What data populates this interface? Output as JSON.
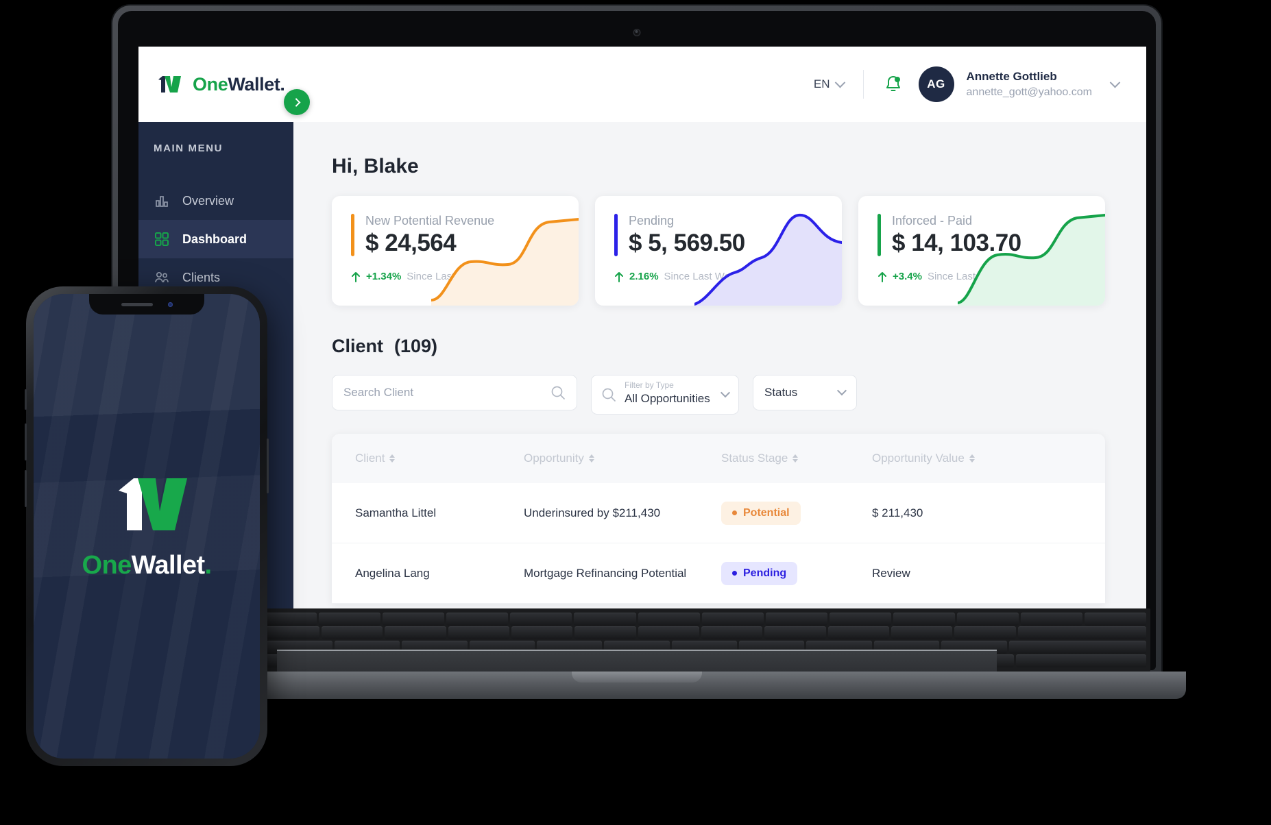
{
  "brand": {
    "logo_one": "One",
    "logo_wallet": "Wallet.",
    "mark_icon": "onewallet-1w-logo-mark"
  },
  "topbar": {
    "language": "EN",
    "language_chevron_icon": "chevron-down-icon",
    "bell_icon": "notification-bell-icon",
    "avatar_initials": "AG",
    "user_name": "Annette Gottlieb",
    "user_email": "annette_gott@yahoo.com",
    "user_chevron_icon": "chevron-down-icon"
  },
  "sidebar": {
    "menu_title": "MAIN MENU",
    "toggle_icon": "chevron-right-icon",
    "items": [
      {
        "label": "Overview",
        "icon": "bar-chart-icon",
        "active": false
      },
      {
        "label": "Dashboard",
        "icon": "grid-squares-icon",
        "active": true
      },
      {
        "label": "Clients",
        "icon": "people-icon",
        "active": false
      }
    ]
  },
  "main": {
    "greeting": "Hi, Blake",
    "stats": [
      {
        "label": "New Potential Revenue",
        "value": "$ 24,564",
        "delta": "+1.34%",
        "delta_caption": "Since Last Week",
        "accent": "#F2911B",
        "fill": "#FDF1E3",
        "trend_icon": "arrow-up-icon"
      },
      {
        "label": "Pending",
        "value": "$ 5, 569.50",
        "delta": "2.16%",
        "delta_caption": "Since Last Week",
        "accent": "#2B21E8",
        "fill": "#E3E1FB",
        "trend_icon": "arrow-up-icon"
      },
      {
        "label": "Inforced - Paid",
        "value": "$ 14, 103.70",
        "delta": "+3.4%",
        "delta_caption": "Since Last Week",
        "accent": "#16A34A",
        "fill": "#E2F6E9",
        "trend_icon": "arrow-up-icon"
      }
    ],
    "client_section": {
      "title": "Client",
      "count": "(109)"
    },
    "filters": {
      "search_placeholder": "Search Client",
      "search_value": "",
      "search_icon": "search-icon",
      "type_label": "Filter by Type",
      "type_value": "All Opportunities",
      "type_icon": "search-icon",
      "type_chevron_icon": "chevron-down-icon",
      "status_value": "Status",
      "status_chevron_icon": "chevron-down-icon"
    },
    "table": {
      "columns": [
        {
          "label": "Client",
          "sort_icon": "sort-arrows-icon"
        },
        {
          "label": "Opportunity",
          "sort_icon": "sort-arrows-icon"
        },
        {
          "label": "Status Stage",
          "sort_icon": "sort-arrows-icon"
        },
        {
          "label": "Opportunity Value",
          "sort_icon": "sort-arrows-icon"
        }
      ],
      "rows": [
        {
          "client": "Samantha Littel",
          "opportunity": "Underinsured by $211,430",
          "status": "Potential",
          "status_kind": "potential",
          "value": "$ 211,430"
        },
        {
          "client": "Angelina Lang",
          "opportunity": "Mortgage Refinancing Potential",
          "status": "Pending",
          "status_kind": "pending",
          "value": "Review"
        }
      ]
    }
  },
  "phone": {
    "splash_one": "One",
    "splash_wallet": "Wallet",
    "splash_dot": ".",
    "mark_icon": "onewallet-1w-logo-mark"
  },
  "chart_data": [
    {
      "type": "area",
      "title": "New Potential Revenue",
      "x": [
        0,
        1,
        2,
        3,
        4,
        5,
        6
      ],
      "values": [
        12,
        30,
        44,
        42,
        40,
        66,
        96
      ],
      "color": "#F2911B",
      "fill": "#FDF1E3",
      "grid": false,
      "legend": "none"
    },
    {
      "type": "area",
      "title": "Pending",
      "x": [
        0,
        1,
        2,
        3,
        4,
        5,
        6
      ],
      "values": [
        6,
        28,
        46,
        50,
        92,
        72,
        70
      ],
      "color": "#2B21E8",
      "fill": "#E3E1FB",
      "grid": false,
      "legend": "none"
    },
    {
      "type": "area",
      "title": "Inforced - Paid",
      "x": [
        0,
        1,
        2,
        3,
        4,
        5,
        6
      ],
      "values": [
        10,
        44,
        56,
        54,
        52,
        76,
        98
      ],
      "color": "#16A34A",
      "fill": "#E2F6E9",
      "grid": false,
      "legend": "none"
    }
  ]
}
